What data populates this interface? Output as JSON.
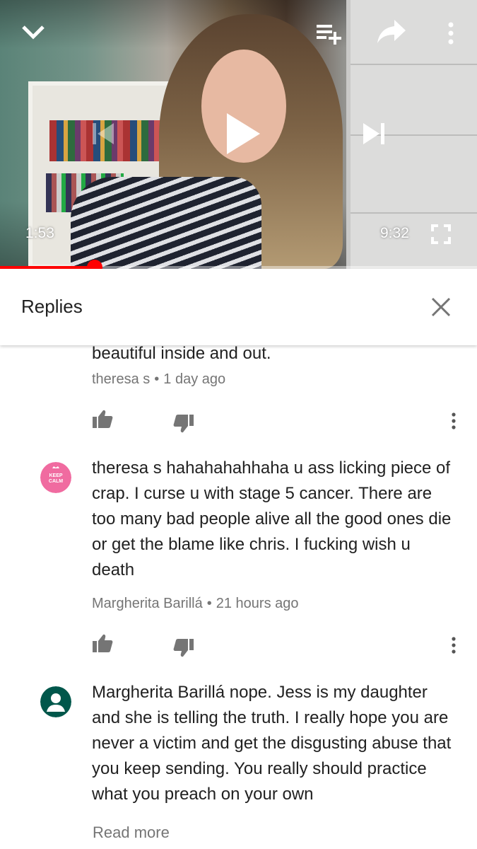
{
  "player": {
    "current_time": "1:53",
    "duration": "9:32",
    "progress_fraction": 0.198,
    "progress_color": "#ff0000",
    "icons": {
      "minimize": "chevron-down-icon",
      "add_to_playlist": "playlist-add-icon",
      "share": "share-icon",
      "more": "more-vert-icon",
      "previous": "skip-previous-icon",
      "play": "play-icon",
      "next": "skip-next-icon",
      "fullscreen": "fullscreen-icon"
    }
  },
  "replies_header": {
    "title": "Replies",
    "close_icon": "close-icon"
  },
  "comments": [
    {
      "text": "beautiful inside and out.",
      "author": "theresa s",
      "time": "1 day ago"
    },
    {
      "text": "theresa s hahahahahhaha u ass licking piece of crap. I curse u with stage 5 cancer. There are too many bad people alive all the good ones die or get the blame like chris. I fucking wish u death",
      "author": "Margherita Barillá",
      "time": "21 hours ago",
      "avatar_lines": [
        "KEEP",
        "CALM"
      ],
      "avatar_color": "#f06ba0"
    },
    {
      "text": "Margherita Barillá nope. Jess is my daughter and she is telling the truth.  I really hope you are never a victim and get the disgusting abuse that you keep sending.  You really should practice what you preach on your own",
      "read_more": "Read more",
      "avatar_color": "#00574b"
    }
  ],
  "meta_separator": "•"
}
